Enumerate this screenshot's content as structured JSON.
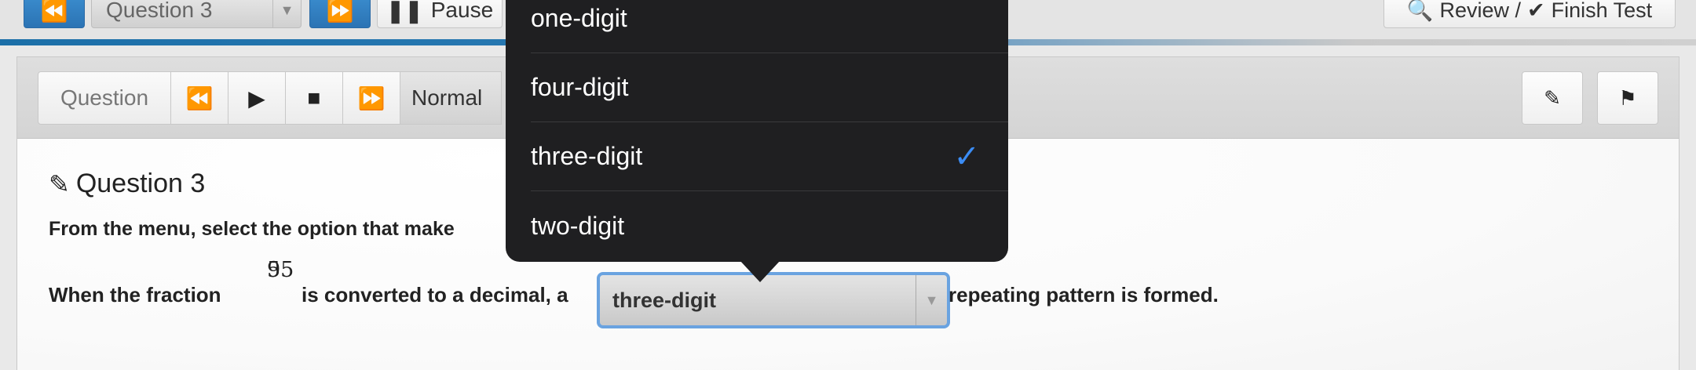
{
  "topbar": {
    "prev_icon": "rewind-icon",
    "question_select": "Question 3",
    "next_icon": "fast-forward-icon",
    "pause_label": "Pause",
    "review_label": "Review /",
    "finish_label": "Finish Test"
  },
  "toolbar": {
    "question_label": "Question",
    "speed_label": "Normal"
  },
  "question": {
    "title": "Question 3",
    "instruction": "From the menu, select the option that make",
    "text_before": "When the fraction",
    "fraction": {
      "numerator": "9",
      "denominator": "55"
    },
    "text_middle": "is converted to a decimal, a",
    "selected_value": "three-digit",
    "text_after": "repeating pattern is formed."
  },
  "popover": {
    "options": [
      {
        "label": "one-digit",
        "selected": false
      },
      {
        "label": "four-digit",
        "selected": false
      },
      {
        "label": "three-digit",
        "selected": true
      },
      {
        "label": "two-digit",
        "selected": false
      }
    ],
    "check_color": "#3b8cf5"
  },
  "colors": {
    "accent_blue": "#2b73b4",
    "popover_bg": "#1f1f21",
    "focus_ring": "#6aa3e0"
  }
}
